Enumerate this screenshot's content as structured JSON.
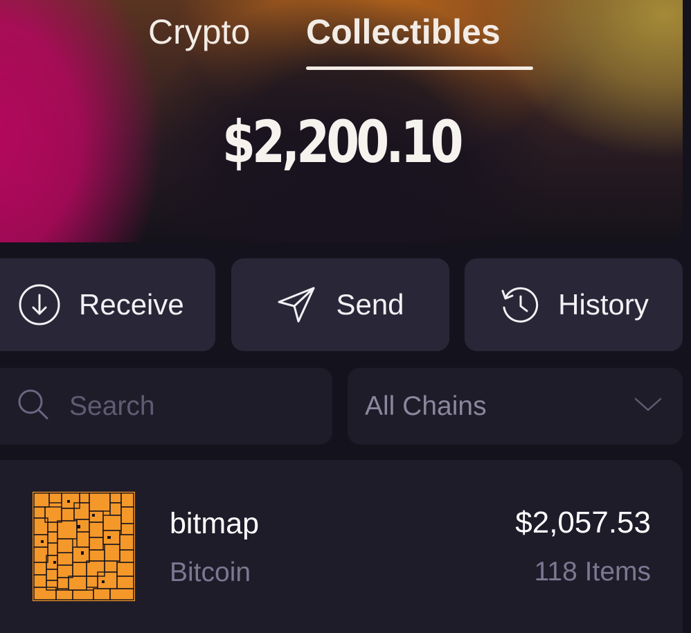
{
  "tabs": [
    {
      "label": "Crypto",
      "active": false
    },
    {
      "label": "Collectibles",
      "active": true
    }
  ],
  "balance": "$2,200.10",
  "actions": {
    "receive": {
      "label": "Receive",
      "icon": "arrow-down-circle-icon"
    },
    "send": {
      "label": "Send",
      "icon": "paper-plane-icon"
    },
    "history": {
      "label": "History",
      "icon": "history-clock-icon"
    }
  },
  "search": {
    "placeholder": "Search",
    "value": ""
  },
  "chain_filter": {
    "selected": "All Chains"
  },
  "collections": [
    {
      "name": "bitmap",
      "chain": "Bitcoin",
      "value": "$2,057.53",
      "items": "118 Items",
      "thumb_color": "#f4982a"
    }
  ],
  "colors": {
    "background": "#14121c",
    "card": "#1e1c29",
    "action_button": "#292737",
    "muted_text": "#7b7892",
    "accent_magenta": "#b5085e",
    "accent_orange": "#b0621c",
    "accent_gold": "#a48a38"
  }
}
